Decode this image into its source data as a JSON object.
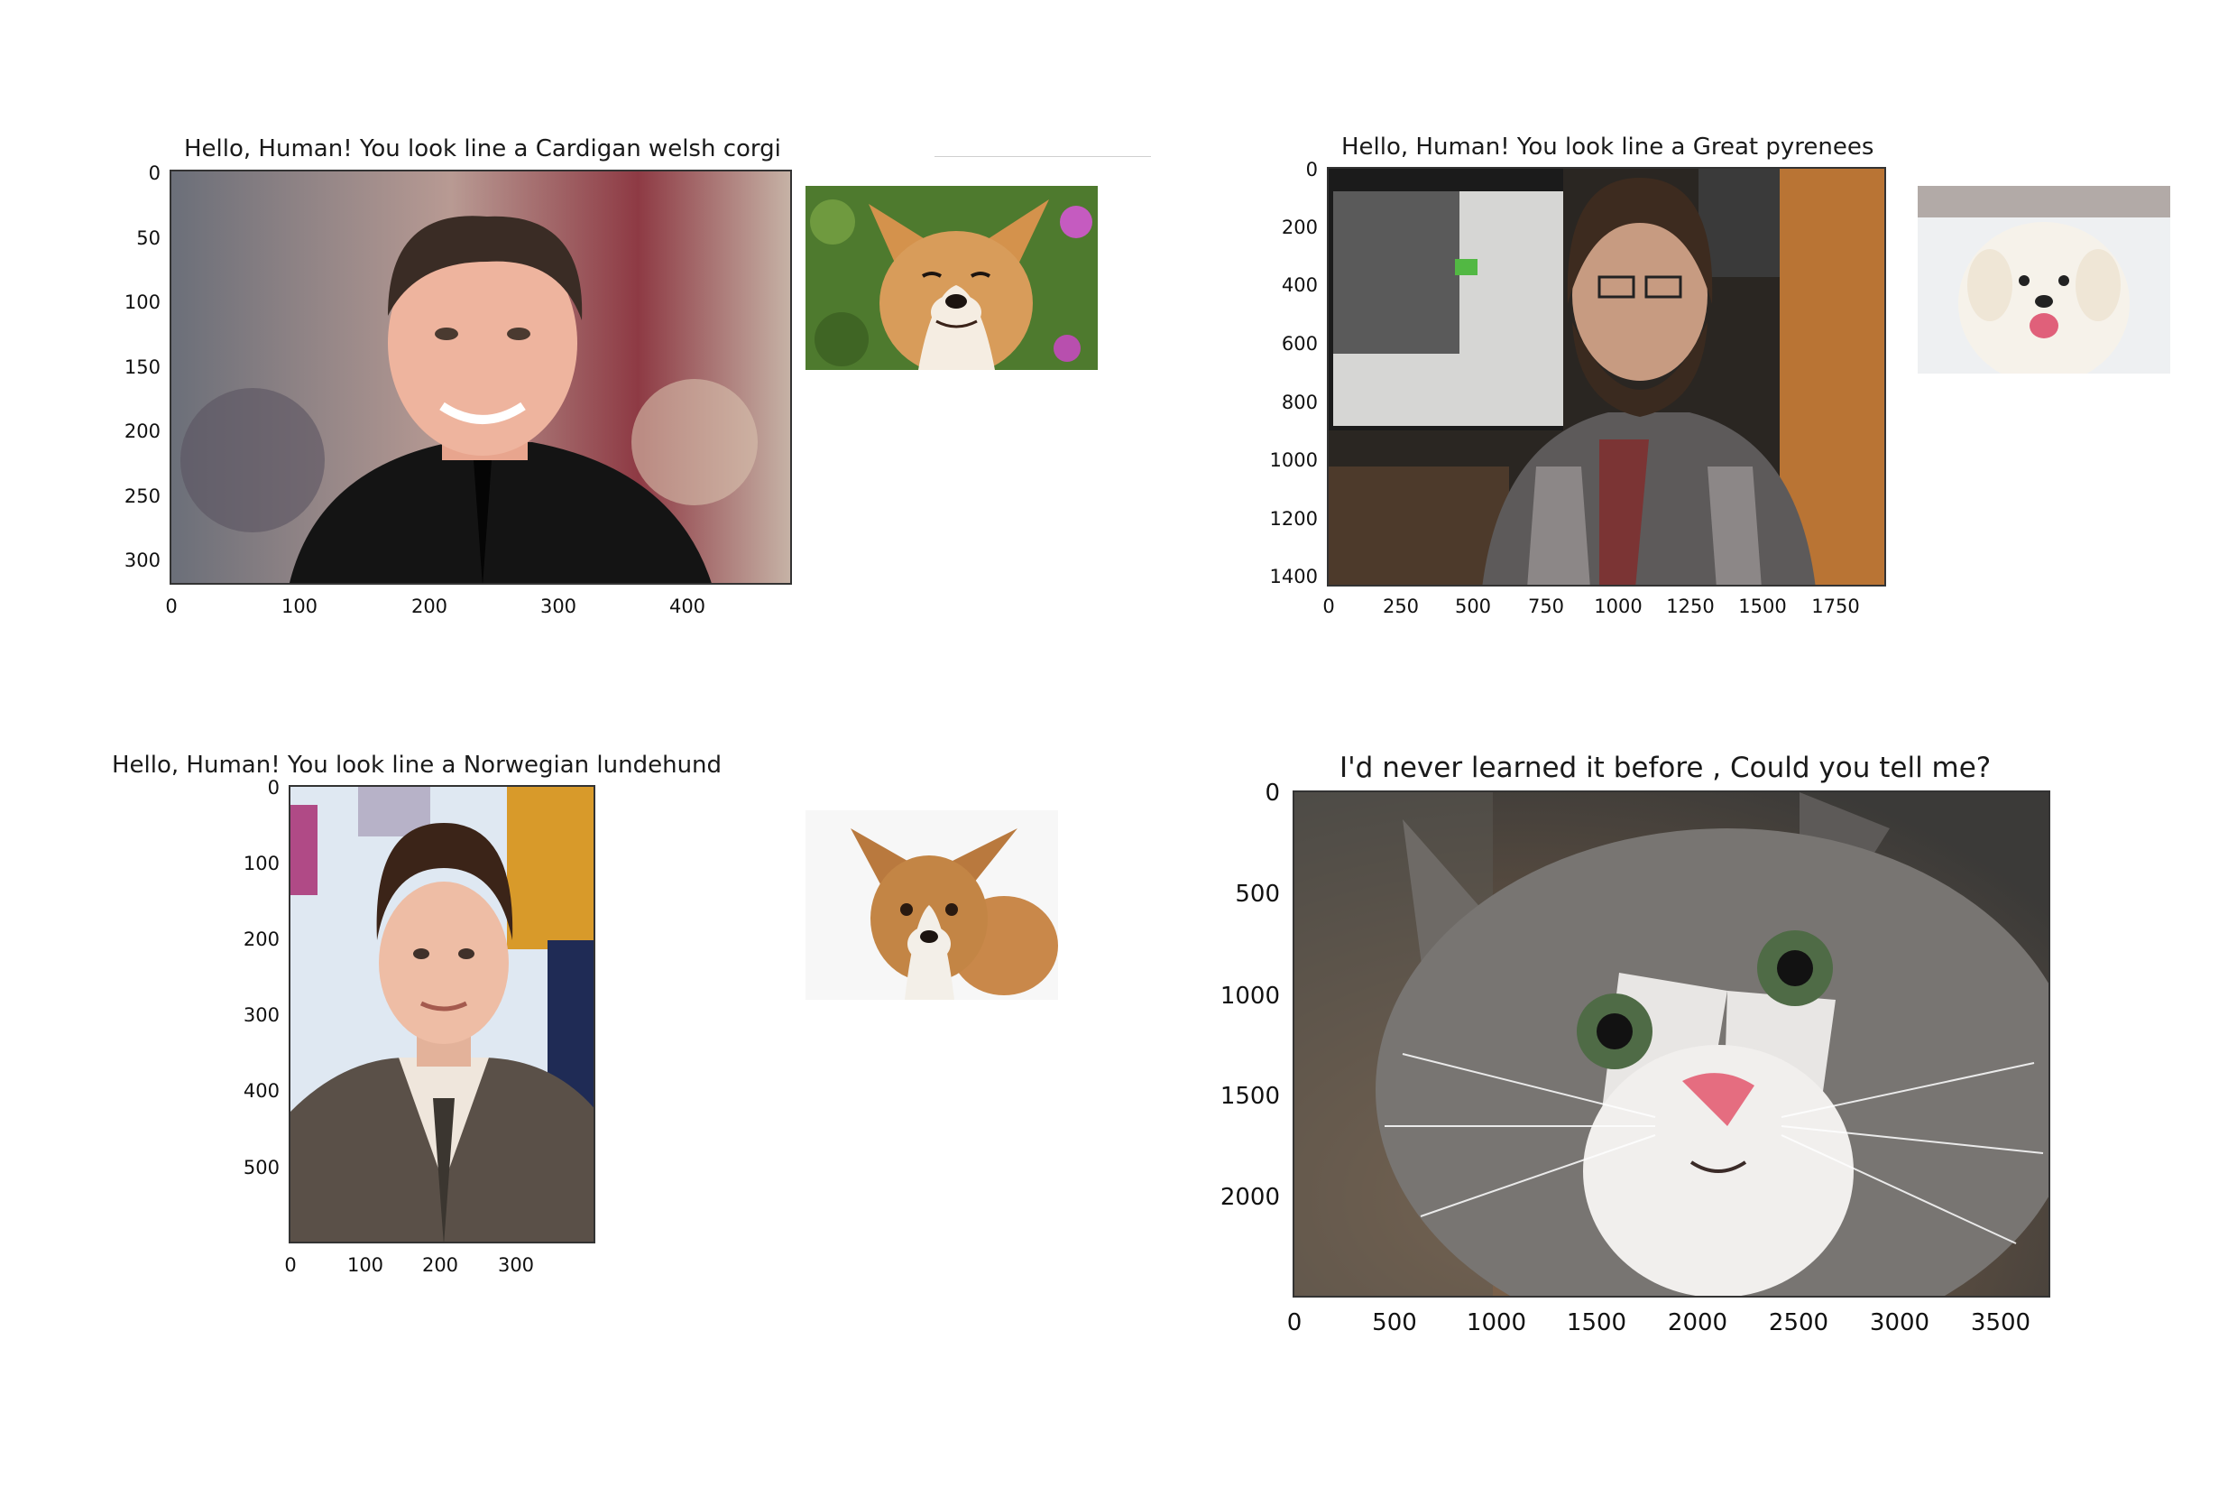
{
  "panels": [
    {
      "title": "Hello, Human! You look line a Cardigan welsh corgi",
      "yticks": [
        "0",
        "50",
        "100",
        "150",
        "200",
        "250",
        "300"
      ],
      "xticks": [
        "0",
        "100",
        "200",
        "300",
        "400"
      ],
      "subject": "human-photo",
      "dog": "cardigan-welsh-corgi"
    },
    {
      "title": "Hello, Human! You look line a Great pyrenees",
      "yticks": [
        "0",
        "200",
        "400",
        "600",
        "800",
        "1000",
        "1200",
        "1400"
      ],
      "xticks": [
        "0",
        "250",
        "500",
        "750",
        "1000",
        "1250",
        "1500",
        "1750"
      ],
      "subject": "human-photo",
      "dog": "great-pyrenees"
    },
    {
      "title": "Hello, Human! You look line a Norwegian lundehund",
      "yticks": [
        "0",
        "100",
        "200",
        "300",
        "400",
        "500"
      ],
      "xticks": [
        "0",
        "100",
        "200",
        "300"
      ],
      "subject": "human-photo",
      "dog": "norwegian-lundehund"
    },
    {
      "title": "I'd never learned it before , Could you tell me?",
      "yticks": [
        "0",
        "500",
        "1000",
        "1500",
        "2000"
      ],
      "xticks": [
        "0",
        "500",
        "1000",
        "1500",
        "2000",
        "2500",
        "3000",
        "3500"
      ],
      "subject": "cat-photo"
    }
  ],
  "colors": {
    "axis": "#333333",
    "background": "#ffffff"
  }
}
